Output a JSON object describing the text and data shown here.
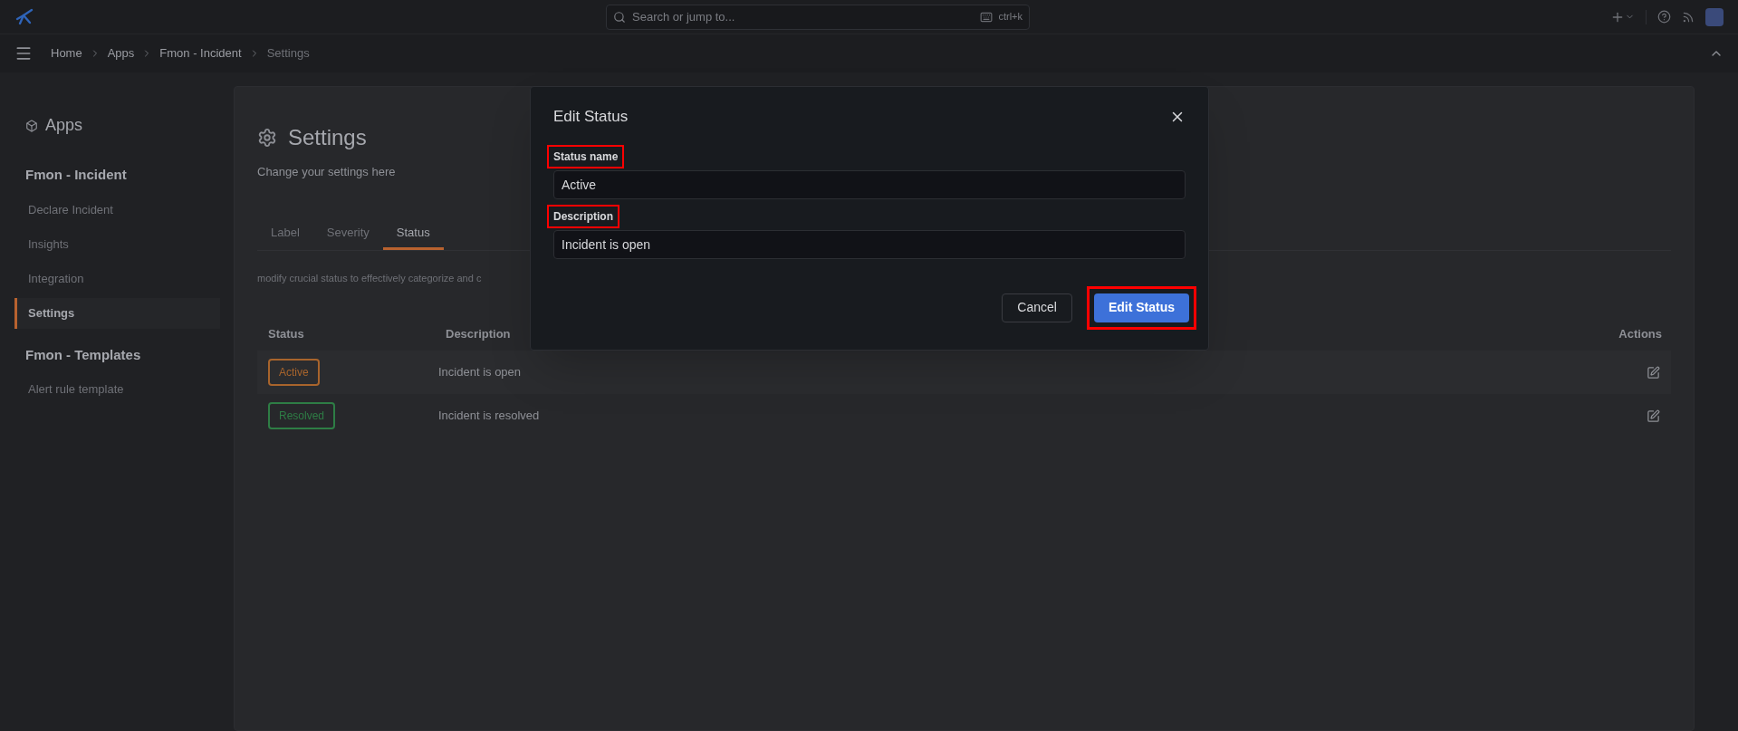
{
  "top_bar": {
    "search": {
      "placeholder": "Search or jump to..."
    },
    "shortcut": "ctrl+k"
  },
  "breadcrumb": [
    "Home",
    "Apps",
    "Fmon - Incident",
    "Settings"
  ],
  "sidebar": {
    "title": "Apps",
    "sections": [
      {
        "heading": "Fmon - Incident",
        "items": [
          {
            "label": "Declare Incident",
            "selected": false
          },
          {
            "label": "Insights",
            "selected": false
          },
          {
            "label": "Integration",
            "selected": false
          },
          {
            "label": "Settings",
            "selected": true
          }
        ]
      },
      {
        "heading": "Fmon - Templates",
        "items": [
          {
            "label": "Alert rule template",
            "selected": false
          }
        ]
      }
    ]
  },
  "page": {
    "title": "Settings",
    "subtitle": "Change your settings here",
    "tabs": [
      {
        "label": "Label",
        "selected": false
      },
      {
        "label": "Severity",
        "selected": false
      },
      {
        "label": "Status",
        "selected": true
      }
    ],
    "hint": "modify crucial status to effectively categorize and c",
    "table": {
      "columns": [
        "Status",
        "Description",
        "Actions"
      ],
      "rows": [
        {
          "status": "Active",
          "color": "#a8642c",
          "description": "Incident is open"
        },
        {
          "status": "Resolved",
          "color": "#2e7d45",
          "description": "Incident is resolved"
        }
      ]
    }
  },
  "dialog": {
    "title": "Edit Status",
    "fields": [
      {
        "label": "Status name",
        "value": "Active",
        "highlighted": true
      },
      {
        "label": "Description",
        "value": "Incident is open",
        "highlighted": true
      }
    ],
    "buttons": [
      {
        "label": "Cancel",
        "kind": "secondary",
        "highlighted": false
      },
      {
        "label": "Edit Status",
        "kind": "primary",
        "highlighted": true
      }
    ]
  }
}
